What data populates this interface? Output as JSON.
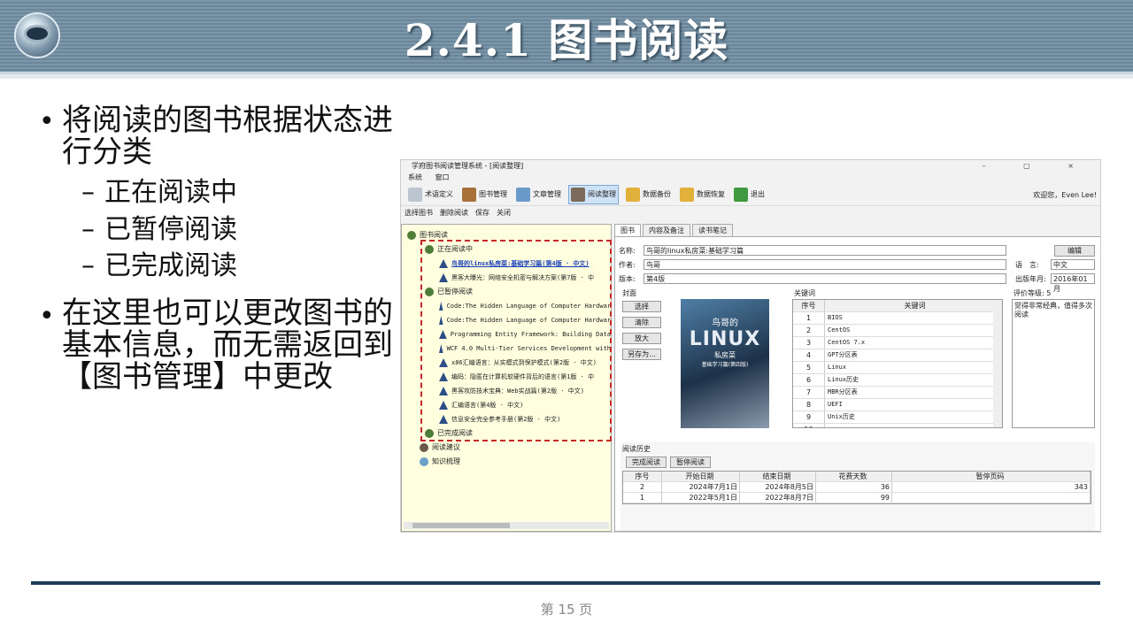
{
  "slide": {
    "title": "2.4.1  图书阅读",
    "bullet1": "将阅读的图书根据状态进行分类",
    "sub1": "正在阅读中",
    "sub2": "已暂停阅读",
    "sub3": "已完成阅读",
    "bullet2": "在这里也可以更改图书的基本信息，而无需返回到【图书管理】中更改",
    "page": "第 15 页",
    "dash": "–",
    "dot": "•"
  },
  "app": {
    "title": "学府图书阅读管理系统 - [阅读整理]",
    "win_controls": "– ▢ ×",
    "menu": [
      "系统",
      "窗口"
    ],
    "toolbar": [
      "术语定义",
      "图书管理",
      "文章管理",
      "阅读整理",
      "数据备份",
      "数据恢复",
      "退出"
    ],
    "welcome": "欢迎您，Even Lee!",
    "toolbar2": [
      "选择图书",
      "删除阅读",
      "保存",
      "关闭"
    ],
    "tree": {
      "root": "图书阅读",
      "reading": "正在阅读中",
      "reading_items": [
        "鸟哥的linux私房菜:基础学习篇(第4版 · 中文)",
        "黑客大曝光：网络安全机密与解决方案(第7版 · 中"
      ],
      "paused": "已暂停阅读",
      "paused_items": [
        "Code:The Hidden Language of Computer Hardwar",
        "Code:The Hidden Language of Computer Hardwar",
        "Programming Entity Framework: Building Data",
        "WCF 4.0 Multi-Tier Services Development with",
        "x86汇编语言：从实模式到保护模式(第2版 · 中文)",
        "编码：隐匿在计算机软硬件背后的语言(第1版 · 中",
        "黑客攻防技术宝典：Web实战篇(第2版 · 中文)",
        "汇编语言(第4版 · 中文)",
        "信息安全完全参考手册(第2版 · 中文)"
      ],
      "done": "已完成阅读",
      "suggest": "阅读建议",
      "knowledge": "知识梳理"
    },
    "tabs": [
      "图书",
      "内容及备注",
      "读书笔记"
    ],
    "form": {
      "name_label": "名称:",
      "name": "鸟哥的linux私房菜:基础学习篇",
      "edit": "编辑",
      "author_label": "作者:",
      "author": "鸟哥",
      "lang_label": "语　言:",
      "lang": "中文",
      "edition_label": "版本:",
      "edition": "第4版",
      "pub_label": "出版年月:",
      "pub": "2016年01月",
      "cover_label": "封面",
      "kw_label": "关键词",
      "rating": "评价等级: 5",
      "note": "觉得非常经典，值得多次阅读"
    },
    "cover_buttons": [
      "选择",
      "清除",
      "放大",
      "另存为..."
    ],
    "cover_text": {
      "c1": "鸟哥的",
      "c2": "LINUX",
      "c3": "私房菜",
      "c4": "基础学习篇(第四版)"
    },
    "kw_header": [
      "序号",
      "关键词"
    ],
    "keywords": [
      [
        "1",
        "BIOS"
      ],
      [
        "2",
        "CentOS"
      ],
      [
        "3",
        "CentOS 7.x"
      ],
      [
        "4",
        "GPT分区表"
      ],
      [
        "5",
        "Linux"
      ],
      [
        "6",
        "Linux历史"
      ],
      [
        "7",
        "MBR分区表"
      ],
      [
        "8",
        "UEFI"
      ],
      [
        "9",
        "Unix历史"
      ],
      [
        "10",
        "..."
      ]
    ],
    "history_label": "阅读历史",
    "history_buttons": [
      "完成阅读",
      "暂停阅读"
    ],
    "history_header": [
      "序号",
      "开始日期",
      "结束日期",
      "花费天数",
      "暂停页码"
    ],
    "history_rows": [
      [
        "2",
        "2024年7月1日",
        "2024年8月5日",
        "36",
        "343"
      ],
      [
        "1",
        "2022年5月1日",
        "2022年8月7日",
        "99",
        ""
      ]
    ]
  }
}
